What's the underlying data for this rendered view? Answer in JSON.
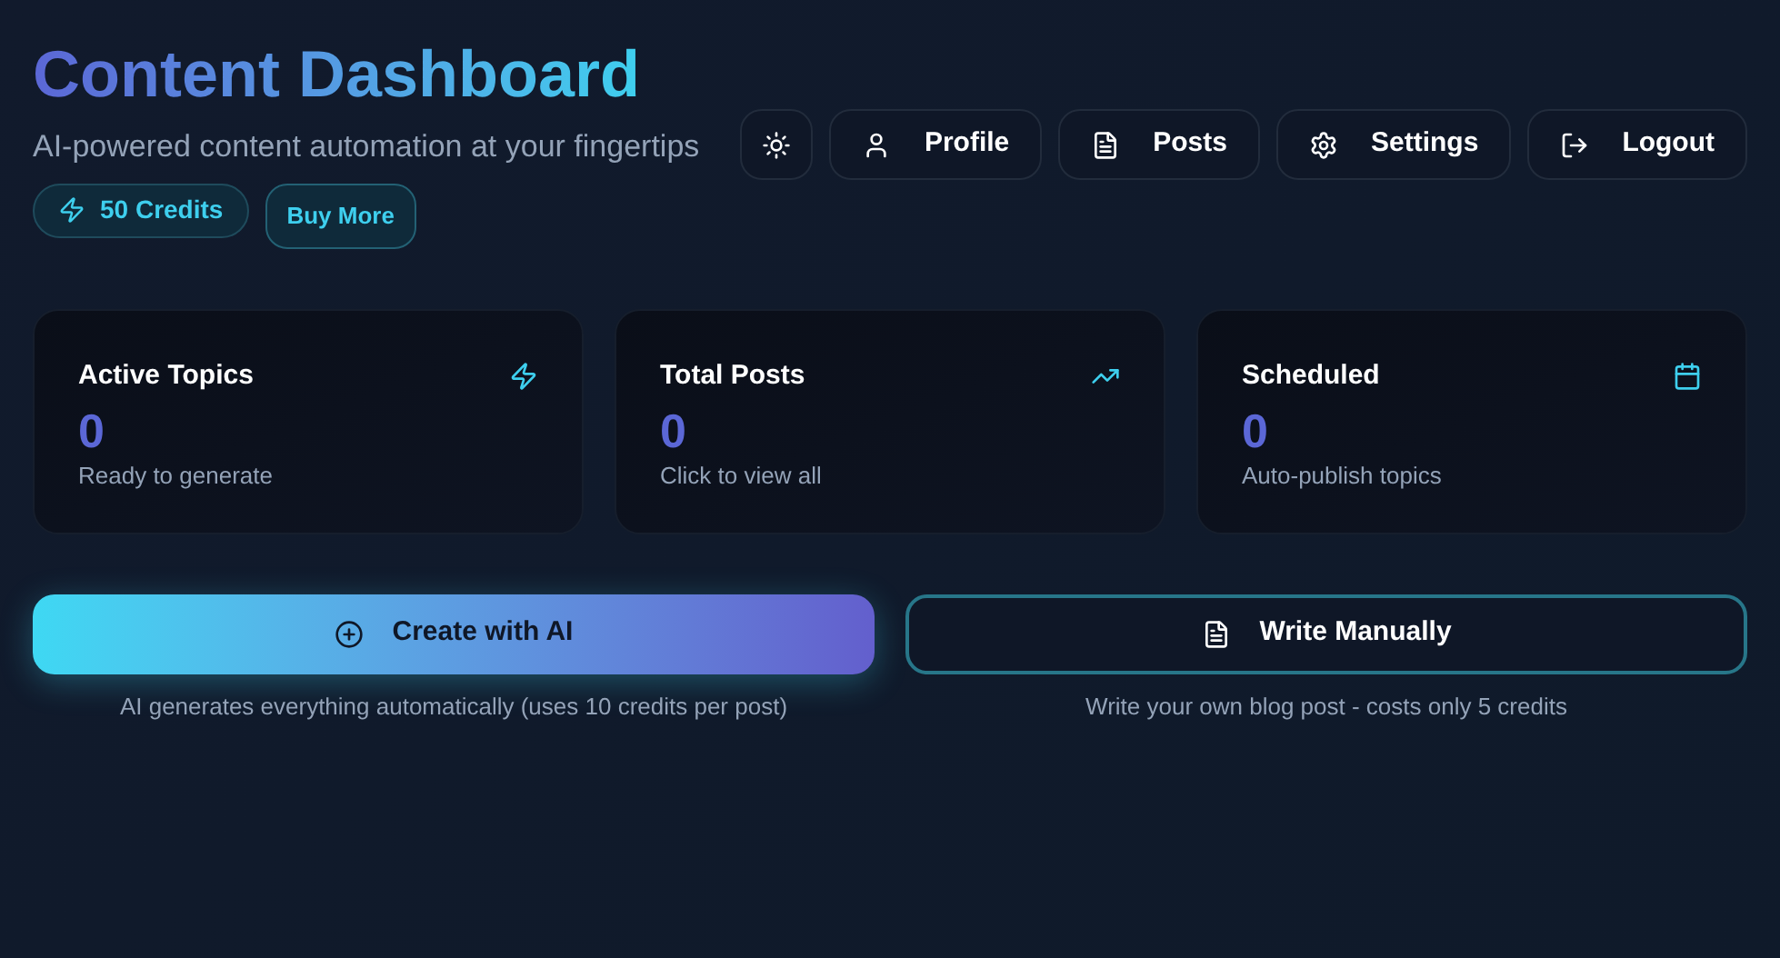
{
  "header": {
    "title": "Content Dashboard",
    "subtitle": "AI-powered content automation at your fingertips",
    "credits": "50 Credits",
    "buy_button": "Buy More"
  },
  "nav": [
    {
      "kind": "theme"
    },
    {
      "kind": "profile",
      "label": "Profile"
    },
    {
      "kind": "posts",
      "label": "Posts"
    },
    {
      "kind": "settings",
      "label": "Settings"
    },
    {
      "kind": "logout",
      "label": "Logout"
    }
  ],
  "stats": [
    {
      "kind": "zap",
      "title": "Active Topics",
      "value": "0",
      "caption": "Ready to generate"
    },
    {
      "kind": "trend",
      "title": "Total Posts",
      "value": "0",
      "caption": "Click to view all"
    },
    {
      "kind": "calendar",
      "title": "Scheduled",
      "value": "0",
      "caption": "Auto-publish topics"
    }
  ],
  "actions": [
    {
      "kind": "primary",
      "label": "Create with AI",
      "caption": "AI generates everything automatically (uses 10 credits per post)"
    },
    {
      "kind": "outline",
      "label": "Write Manually",
      "caption": "Write your own blog post - costs only 5 credits"
    }
  ]
}
